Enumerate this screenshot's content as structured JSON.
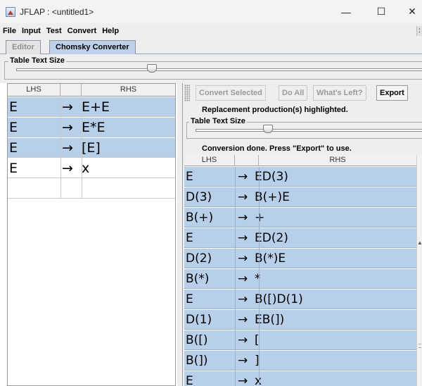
{
  "window": {
    "title": "JFLAP : <untitled1>",
    "minimize": "—",
    "maximize": "☐",
    "close": "✕"
  },
  "menu": [
    "File",
    "Input",
    "Test",
    "Convert",
    "Help"
  ],
  "tabs": {
    "editor": "Editor",
    "chomsky": "Chomsky Converter"
  },
  "table_text_size_label": "Table Text Size",
  "left_table": {
    "headers": [
      "LHS",
      "",
      "RHS"
    ],
    "arrow": "→",
    "rows": [
      {
        "lhs": "E",
        "rhs": "E+E"
      },
      {
        "lhs": "E",
        "rhs": "E*E"
      },
      {
        "lhs": "E",
        "rhs": "[E]"
      },
      {
        "lhs": "E",
        "rhs": "x"
      }
    ]
  },
  "toolbar": {
    "convert_selected": "Convert Selected",
    "do_all": "Do All",
    "whats_left": "What's Left?",
    "export": "Export"
  },
  "messages": {
    "replacement": "Replacement production(s) highlighted.",
    "done": "Conversion done.  Press \"Export\" to use."
  },
  "right_table": {
    "headers": [
      "LHS",
      "",
      "RHS"
    ],
    "arrow": "→",
    "rows": [
      {
        "lhs": "E",
        "rhs": "ED(3)"
      },
      {
        "lhs": "D(3)",
        "rhs": "B(+)E"
      },
      {
        "lhs": "B(+)",
        "rhs": "+"
      },
      {
        "lhs": "E",
        "rhs": "ED(2)"
      },
      {
        "lhs": "D(2)",
        "rhs": "B(*)E"
      },
      {
        "lhs": "B(*)",
        "rhs": "*"
      },
      {
        "lhs": "E",
        "rhs": "B([)D(1)"
      },
      {
        "lhs": "D(1)",
        "rhs": "EB(])"
      },
      {
        "lhs": "B([)",
        "rhs": "["
      },
      {
        "lhs": "B(])",
        "rhs": "]"
      },
      {
        "lhs": "E",
        "rhs": "x"
      }
    ]
  },
  "colors": {
    "selection": "#b8cfe9",
    "tab_active": "#bed0ea"
  }
}
